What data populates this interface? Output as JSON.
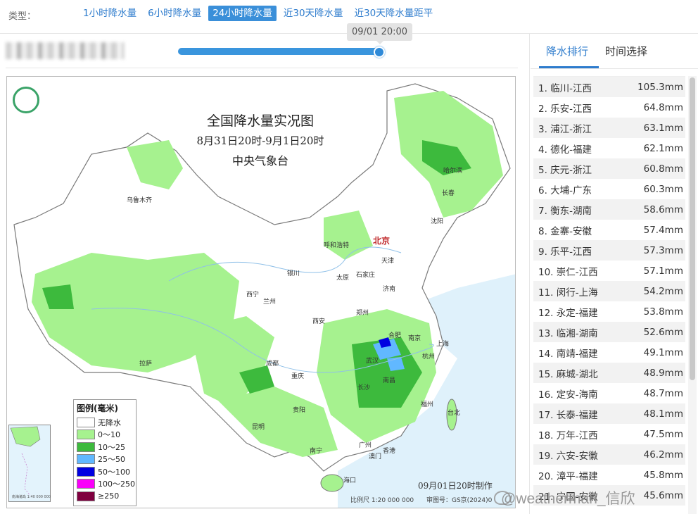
{
  "type_bar": {
    "label": "类型：",
    "tabs": [
      "1小时降水量",
      "6小时降水量",
      "24小时降水量",
      "近30天降水量",
      "近30天降水量距平"
    ],
    "active_index": 2
  },
  "slider": {
    "tooltip": "09/01 20:00",
    "progress": 1.0
  },
  "map": {
    "title": "全国降水量实况图",
    "subtitle": "8月31日20时-9月1日20时",
    "agency": "中央气象台",
    "capital": "北京",
    "cities": [
      "乌鲁木齐",
      "哈尔滨",
      "长春",
      "沈阳",
      "呼和浩特",
      "天津",
      "银川",
      "太原",
      "石家庄",
      "济南",
      "西宁",
      "兰州",
      "郑州",
      "西安",
      "合肥",
      "南京",
      "上海",
      "杭州",
      "武汉",
      "成都",
      "重庆",
      "长沙",
      "南昌",
      "福州",
      "拉萨",
      "贵阳",
      "昆明",
      "台北",
      "南宁",
      "广州",
      "香港",
      "澳门",
      "海口"
    ],
    "legend": {
      "title": "图例(毫米)",
      "items": [
        {
          "label": "无降水",
          "color": "#ffffff"
        },
        {
          "label": "0～10",
          "color": "#a6f28f"
        },
        {
          "label": "10～25",
          "color": "#3dba3d"
        },
        {
          "label": "25～50",
          "color": "#61b8ff"
        },
        {
          "label": "50～100",
          "color": "#0000e1"
        },
        {
          "label": "100～250",
          "color": "#fa00fa"
        },
        {
          "label": "≥250",
          "color": "#800040"
        }
      ]
    },
    "made_time": "09月01日20时制作",
    "scale": "比例尺 1:20 000 000",
    "review": "审图号：GS京(2024)0",
    "inset_note": "南海诸岛 1:40 000 000"
  },
  "watermark": "@weatherman_信欣",
  "right_panel": {
    "tabs": [
      "降水排行",
      "时间选择"
    ],
    "active_tab": 0,
    "ranking": [
      {
        "name": "1. 临川-江西",
        "value": "105.3mm"
      },
      {
        "name": "2. 乐安-江西",
        "value": "64.8mm"
      },
      {
        "name": "3. 浦江-浙江",
        "value": "63.1mm"
      },
      {
        "name": "4. 德化-福建",
        "value": "62.1mm"
      },
      {
        "name": "5. 庆元-浙江",
        "value": "60.8mm"
      },
      {
        "name": "6. 大埔-广东",
        "value": "60.3mm"
      },
      {
        "name": "7. 衡东-湖南",
        "value": "58.6mm"
      },
      {
        "name": "8. 金寨-安徽",
        "value": "57.4mm"
      },
      {
        "name": "9. 乐平-江西",
        "value": "57.3mm"
      },
      {
        "name": "10. 崇仁-江西",
        "value": "57.1mm"
      },
      {
        "name": "11. 闵行-上海",
        "value": "54.2mm"
      },
      {
        "name": "12. 永定-福建",
        "value": "53.8mm"
      },
      {
        "name": "13. 临湘-湖南",
        "value": "52.6mm"
      },
      {
        "name": "14. 南靖-福建",
        "value": "49.1mm"
      },
      {
        "name": "15. 麻城-湖北",
        "value": "48.9mm"
      },
      {
        "name": "16. 定安-海南",
        "value": "48.7mm"
      },
      {
        "name": "17. 长泰-福建",
        "value": "48.1mm"
      },
      {
        "name": "18. 万年-江西",
        "value": "47.5mm"
      },
      {
        "name": "19. 六安-安徽",
        "value": "46.2mm"
      },
      {
        "name": "20. 漳平-福建",
        "value": "45.8mm"
      },
      {
        "name": "21. 宁国-安徽",
        "value": "45.6mm"
      }
    ]
  }
}
